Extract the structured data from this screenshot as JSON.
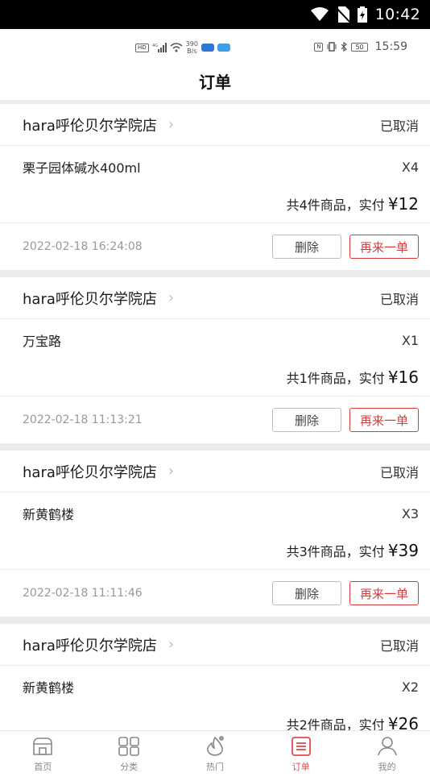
{
  "system_status": {
    "time": "10:42"
  },
  "inner_status": {
    "net_speed_value": "390",
    "net_speed_unit": "B/s",
    "battery": "50",
    "time": "15:59"
  },
  "header": {
    "title": "订单"
  },
  "orders": [
    {
      "store": "hara呼伦贝尔学院店",
      "status": "已取消",
      "item": "栗子园体碱水400ml",
      "qty": "X4",
      "summary": "共4件商品，实付",
      "price": "¥12",
      "date": "2022-02-18 16:24:08",
      "delete_label": "删除",
      "reorder_label": "再来一单"
    },
    {
      "store": "hara呼伦贝尔学院店",
      "status": "已取消",
      "item": "万宝路",
      "qty": "X1",
      "summary": "共1件商品，实付",
      "price": "¥16",
      "date": "2022-02-18 11:13:21",
      "delete_label": "删除",
      "reorder_label": "再来一单"
    },
    {
      "store": "hara呼伦贝尔学院店",
      "status": "已取消",
      "item": "新黄鹤楼",
      "qty": "X3",
      "summary": "共3件商品，实付",
      "price": "¥39",
      "date": "2022-02-18 11:11:46",
      "delete_label": "删除",
      "reorder_label": "再来一单"
    },
    {
      "store": "hara呼伦贝尔学院店",
      "status": "已取消",
      "item": "新黄鹤楼",
      "qty": "X2",
      "summary": "共2件商品，实付",
      "price": "¥26"
    }
  ],
  "nav": [
    {
      "label": "首页",
      "icon": "home-icon"
    },
    {
      "label": "分类",
      "icon": "category-grid-icon"
    },
    {
      "label": "热门",
      "icon": "flame-icon"
    },
    {
      "label": "订单",
      "icon": "orders-list-icon",
      "active": true
    },
    {
      "label": "我的",
      "icon": "user-icon"
    }
  ],
  "colors": {
    "accent": "#e24b4b",
    "separator": "#ececec",
    "date_gray": "#999999"
  }
}
